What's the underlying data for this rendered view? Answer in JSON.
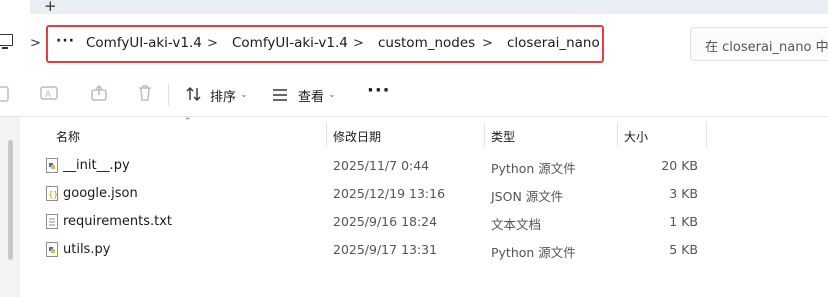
{
  "tabs": {
    "new_tab_label": "+"
  },
  "breadcrumb": {
    "overflow": "···",
    "items": [
      "ComfyUI-aki-v1.4",
      "ComfyUI-aki-v1.4",
      "custom_nodes",
      "closerai_nano"
    ],
    "highlight_color": "#e53e3e"
  },
  "search": {
    "placeholder": "在 closerai_nano 中搜"
  },
  "toolbar": {
    "sort_label": "排序",
    "view_label": "查看",
    "more_label": "···"
  },
  "columns": {
    "name": "名称",
    "modified": "修改日期",
    "type": "类型",
    "size": "大小"
  },
  "files": [
    {
      "name": "__init__.py",
      "modified": "2025/11/7 0:44",
      "type": "Python 源文件",
      "size": "20 KB",
      "icon": "python-file-icon"
    },
    {
      "name": "google.json",
      "modified": "2025/12/19 13:16",
      "type": "JSON 源文件",
      "size": "3 KB",
      "icon": "json-file-icon"
    },
    {
      "name": "requirements.txt",
      "modified": "2025/9/16 18:24",
      "type": "文本文档",
      "size": "1 KB",
      "icon": "text-file-icon"
    },
    {
      "name": "utils.py",
      "modified": "2025/9/17 13:31",
      "type": "Python 源文件",
      "size": "5 KB",
      "icon": "python-file-icon"
    }
  ]
}
